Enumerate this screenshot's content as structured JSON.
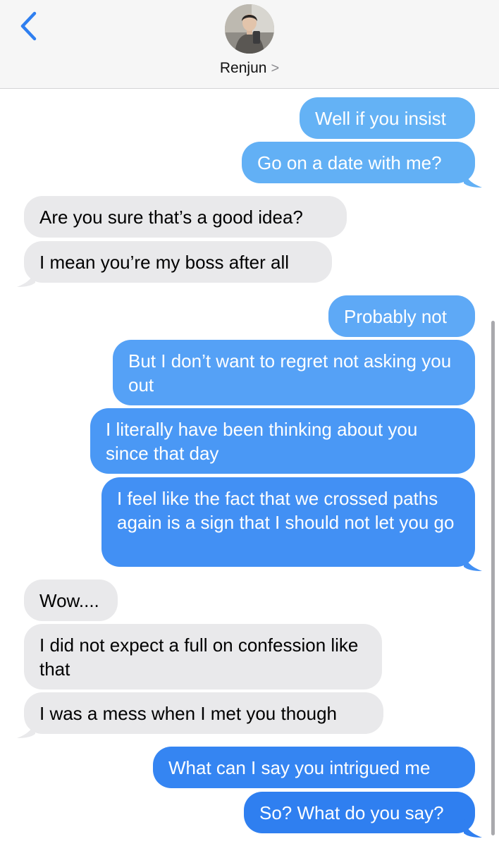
{
  "contact": {
    "name": "Renjun",
    "chevron": ">"
  },
  "icons": {
    "back": "back-chevron-icon",
    "disclosure": "chevron-right-icon",
    "avatar": "contact-photo"
  },
  "colors": {
    "outgoing_top": "#64b2f5",
    "outgoing_bottom": "#2f7ff0",
    "incoming": "#e9e9eb",
    "header": "#f6f6f6"
  },
  "messages": [
    {
      "from": "me",
      "text": "Well if you insist"
    },
    {
      "from": "me",
      "text": "Go on a date with me?"
    },
    {
      "from": "them",
      "text": "Are you sure that’s a good idea?"
    },
    {
      "from": "them",
      "text": "I mean you’re my boss after all"
    },
    {
      "from": "me",
      "text": "Probably not"
    },
    {
      "from": "me",
      "text": "But I don’t want to regret not asking you out"
    },
    {
      "from": "me",
      "text": "I literally have been thinking about you since that day"
    },
    {
      "from": "me",
      "text": "I feel like the fact that we crossed paths again is a sign that I should not let you go"
    },
    {
      "from": "them",
      "text": "Wow...."
    },
    {
      "from": "them",
      "text": "I did not expect a full on confession like that"
    },
    {
      "from": "them",
      "text": "I was a mess when I met you though"
    },
    {
      "from": "me",
      "text": "What can I say you intrigued me"
    },
    {
      "from": "me",
      "text": "So? What do you say?"
    }
  ]
}
